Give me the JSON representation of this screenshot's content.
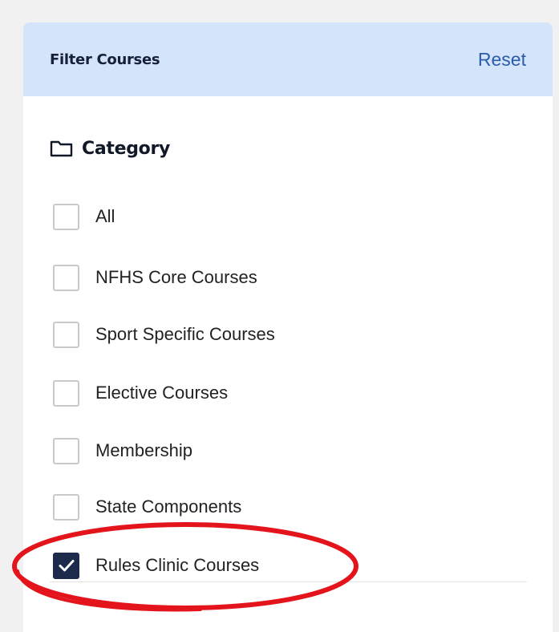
{
  "filter": {
    "title": "Filter Courses",
    "reset_label": "Reset"
  },
  "category": {
    "heading": "Category",
    "heading_icon": "folder-icon",
    "items": [
      {
        "label": "All",
        "checked": false
      },
      {
        "label": "NFHS Core Courses",
        "checked": false
      },
      {
        "label": "Sport Specific Courses",
        "checked": false
      },
      {
        "label": "Elective Courses",
        "checked": false
      },
      {
        "label": "Membership",
        "checked": false
      },
      {
        "label": "State Components",
        "checked": false
      },
      {
        "label": "Rules Clinic Courses",
        "checked": true
      }
    ]
  },
  "annotation": {
    "shape": "ellipse",
    "color": "#e3141b",
    "target": "Rules Clinic Courses"
  },
  "colors": {
    "header_bg": "#d4e5fb",
    "reset_link": "#2c5ba8",
    "checkbox_checked": "#1c2a4c"
  }
}
